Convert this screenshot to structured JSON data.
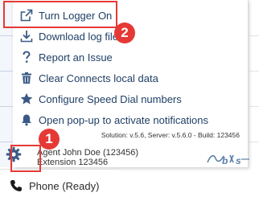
{
  "menu": {
    "items": [
      {
        "icon": "external-link-icon",
        "label": "Turn Logger On"
      },
      {
        "icon": "download-icon",
        "label": "Download log file"
      },
      {
        "icon": "question-icon",
        "label": "Report an Issue"
      },
      {
        "icon": "trash-icon",
        "label": "Clear Connects local data"
      },
      {
        "icon": "star-icon",
        "label": "Configure Speed Dial numbers"
      },
      {
        "icon": "bell-icon",
        "label": "Open pop-up to activate notifications"
      }
    ],
    "version_text": "Solution: v.5.6, Server: v.5.6.0 - Build: 123456"
  },
  "agent": {
    "name_line": "Agent John Doe (123456)",
    "extension_line": "Extension 123456"
  },
  "settings": {
    "icon": "gear-icon"
  },
  "logo": {
    "icon": "brand-logo"
  },
  "phone": {
    "icon": "phone-icon",
    "label": "Phone (Ready)"
  },
  "annotations": [
    {
      "number": "1",
      "target": "settings-gear"
    },
    {
      "number": "2",
      "target": "Turn Logger On"
    }
  ],
  "colors": {
    "menu_text": "#1f3f66",
    "icon": "#3a5a85",
    "highlight": "#e53935"
  }
}
